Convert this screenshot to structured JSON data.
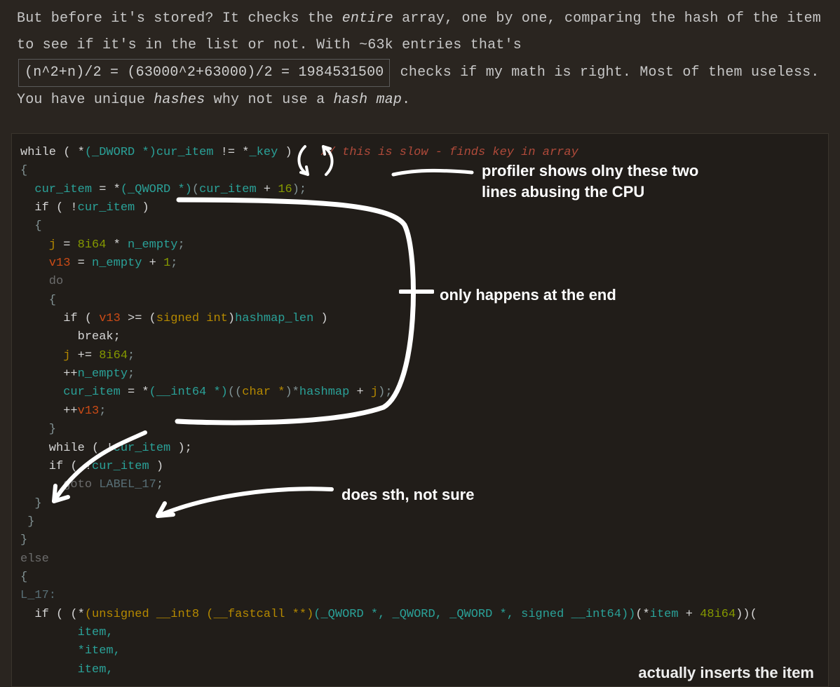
{
  "prose": {
    "p1a": "But before it's stored? It checks the ",
    "p1b_em": "entire",
    "p1c": " array, one by one, comparing the hash of the item to see if it's in the list or not. With ~63k entries that's ",
    "math": "(n^2+n)/2 = (63000^2+63000)/2 = 1984531500",
    "p1d": " checks if my math is right. Most of them useless. You have unique ",
    "p1e_em": "hashes",
    "p1f": " why not use a ",
    "p1g_em": "hash map",
    "p1h": "."
  },
  "comment_slow": "// this is slow - finds key in array",
  "annotations": {
    "a1_line1": "profiler shows olny these two",
    "a1_line2": "lines abusing the CPU",
    "a2": "only happens at the end",
    "a3": "does sth, not sure",
    "a4": "actually inserts the item"
  },
  "code": {
    "l1_a": "while ( *",
    "l1_b": "(_DWORD *)",
    "l1_c": "cur_item",
    "l1_d": " != *",
    "l1_e": "_key",
    "l1_f": " )",
    "l2": "{",
    "l3_a": "  cur_item",
    "l3_b": " = *",
    "l3_c": "(_QWORD *)",
    "l3_d": "(",
    "l3_e": "cur_item",
    "l3_f": " + ",
    "l3_g": "16",
    "l3_h": ");",
    "l4_a": "  if ( !",
    "l4_b": "cur_item",
    "l4_c": " )",
    "l5": "  {",
    "l6_a": "    j",
    "l6_b": " = ",
    "l6_c": "8i64",
    "l6_d": " * ",
    "l6_e": "n_empty",
    "l6_f": ";",
    "l7_a": "    v13",
    "l7_b": " = ",
    "l7_c": "n_empty",
    "l7_d": " + ",
    "l7_e": "1",
    "l7_f": ";",
    "l8": "    do",
    "l9": "    {",
    "l10_a": "      if ( ",
    "l10_b": "v13",
    "l10_c": " >= (",
    "l10_d": "signed int",
    "l10_e": ")",
    "l10_f": "hashmap_len",
    "l10_g": " )",
    "l11": "        break;",
    "l12_a": "      j",
    "l12_b": " += ",
    "l12_c": "8i64",
    "l12_d": ";",
    "l13_a": "      ++",
    "l13_b": "n_empty",
    "l13_c": ";",
    "l14_a": "      cur_item",
    "l14_b": " = *",
    "l14_c": "(__int64 *)",
    "l14_d": "((",
    "l14_e": "char *",
    "l14_f": ")*",
    "l14_g": "hashmap",
    "l14_h": " + ",
    "l14_i": "j",
    "l14_j": ");",
    "l15_a": "      ++",
    "l15_b": "v13",
    "l15_c": ";",
    "l16": "    }",
    "l17_a": "    while ( !",
    "l17_b": "cur_item",
    "l17_c": " );",
    "l18_a": "    if ( !",
    "l18_b": "cur_item",
    "l18_c": " )",
    "l19_a": "      goto ",
    "l19_b": "LABEL_17",
    "l19_c": ";",
    "l20": "  }",
    "l21": " }",
    "l22": "}",
    "l23": "else",
    "l24": "{",
    "l25": "L_17:",
    "l26_a": "  if ( (*",
    "l26_b": "(unsigned __int8 (__fastcall **)",
    "l26_c": "(_QWORD *, _QWORD, _QWORD *, signed __int64))",
    "l26_d": "(*",
    "l26_e": "item",
    "l26_f": " + ",
    "l26_g": "48i64",
    "l26_h": "))(",
    "l27": "        item,",
    "l28": "        *item,",
    "l29": "        item,"
  }
}
